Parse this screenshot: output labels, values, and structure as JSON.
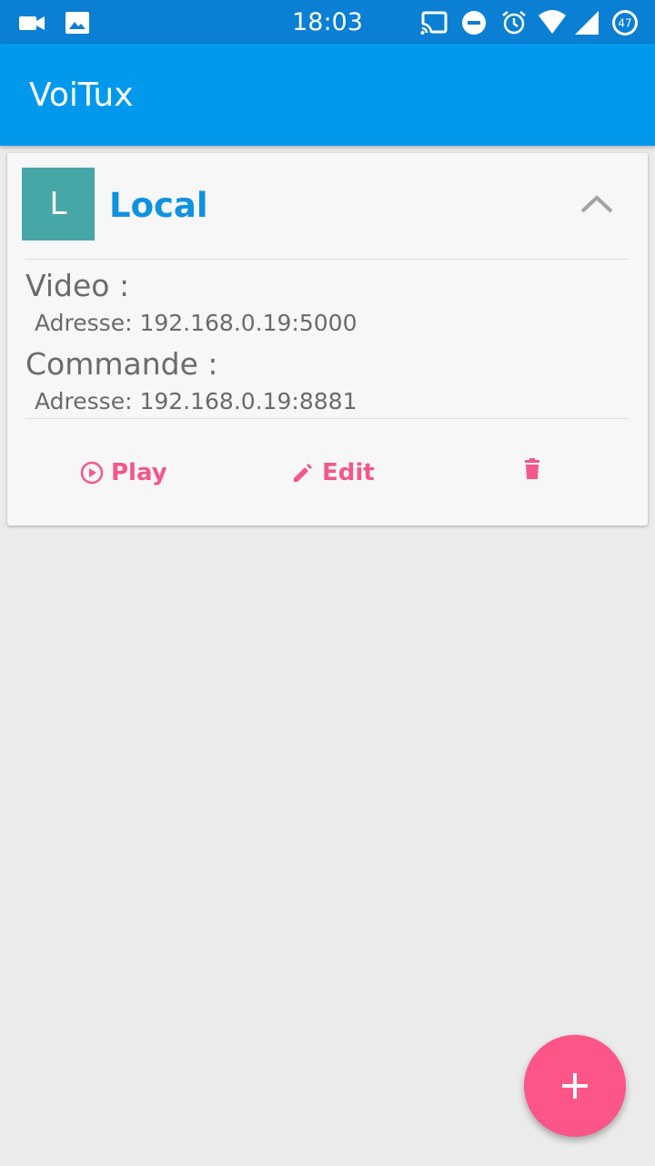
{
  "status_bar": {
    "time": "18:03",
    "battery": "47",
    "icons_left": [
      "video-camera-icon",
      "image-icon"
    ],
    "icons_right": [
      "cast-icon",
      "do-not-disturb-icon",
      "alarm-icon",
      "wifi-icon",
      "signal-icon",
      "battery-icon"
    ]
  },
  "app_bar": {
    "title": "VoiTux"
  },
  "card": {
    "avatar_letter": "L",
    "title": "Local",
    "video_label": "Video :",
    "video_address": "Adresse: 192.168.0.19:5000",
    "command_label": "Commande :",
    "command_address": "Adresse: 192.168.0.19:8881",
    "actions": {
      "play": "Play",
      "edit": "Edit"
    }
  },
  "colors": {
    "status_bar": "#0a7fd3",
    "app_bar": "#0299ed",
    "accent": "#f4578c",
    "avatar": "#47a6a6",
    "card_title": "#0f92e0"
  }
}
